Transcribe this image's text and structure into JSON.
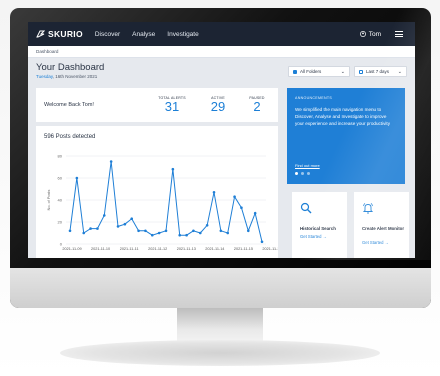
{
  "app": {
    "brand": "SKURIO",
    "nav": [
      "Discover",
      "Analyse",
      "Investigate"
    ],
    "user": "Tom"
  },
  "breadcrumb": "Dashboard",
  "header": {
    "title": "Your Dashboard",
    "day": "Tuesday",
    "date": "16th November 2021",
    "folder_filter": "All Folders",
    "time_filter": "Last 7 days"
  },
  "welcome": {
    "message": "Welcome Back Tom!",
    "stats": [
      {
        "label": "TOTAL ALERTS",
        "value": "31"
      },
      {
        "label": "ACTIVE",
        "value": "29"
      },
      {
        "label": "PAUSED",
        "value": "2"
      }
    ]
  },
  "announcement": {
    "heading": "ANNOUNCEMENTS",
    "body": "We simplified the main navigation menu to Discover, Analyse and Investigate to improve your experience and increase your productivity",
    "link": "Find out more"
  },
  "quick_actions": [
    {
      "title": "Historical Search",
      "action": "Get Started →",
      "icon": "search-icon"
    },
    {
      "title": "Create Alert Monitor",
      "action": "Get Started →",
      "icon": "bell-icon"
    }
  ],
  "colors": {
    "accent": "#1f7fd6",
    "topbar": "#1c2433"
  },
  "chart_data": {
    "type": "line",
    "title": "596 Posts detected",
    "ylabel": "No. of Posts",
    "xlabel": "",
    "ylim": [
      0,
      80
    ],
    "yticks": [
      0,
      20,
      40,
      60,
      80
    ],
    "x_tick_labels": [
      "2021-11-09",
      "2021-11-10",
      "2021-11-11",
      "2021-11-12",
      "2021-11-13",
      "2021-11-14",
      "2021-11-15",
      "2021-11-16"
    ],
    "series": [
      {
        "values": [
          12,
          60,
          10,
          14,
          14,
          26,
          75,
          16,
          18,
          23,
          12,
          12,
          8,
          10,
          12,
          68,
          8,
          8,
          12,
          10,
          17,
          47,
          12,
          10,
          43,
          33,
          12,
          28,
          2
        ]
      }
    ],
    "grid": "horizontal"
  }
}
